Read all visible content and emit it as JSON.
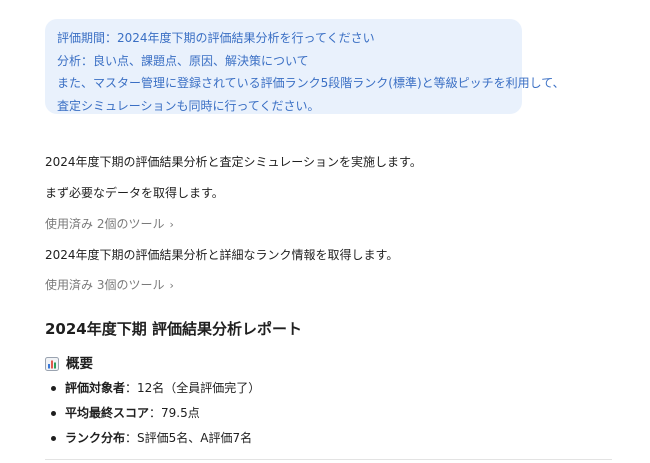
{
  "user_message": {
    "lines": [
      "評価期間：2024年度下期の評価結果分析を行ってください",
      "分析：良い点、課題点、原因、解決策について",
      "また、マスター管理に登録されている評価ランク5段階ランク(標準)と等級ピッチを利用して、",
      "査定シミュレーションも同時に行ってください。"
    ]
  },
  "assistant": {
    "intro": "2024年度下期の評価結果分析と査定シミュレーションを実施します。",
    "step1": "まず必要なデータを取得します。",
    "tools1": "使用済み 2個のツール",
    "step2": "2024年度下期の評価結果分析と詳細なランク情報を取得します。",
    "tools2": "使用済み 3個のツール",
    "chevron": "›",
    "report_title": "2024年度下期 評価結果分析レポート",
    "overview_icon": "bar-chart-icon",
    "overview_title": "概要",
    "bullets": [
      {
        "label": "評価対象者",
        "value": "：12名（全員評価完了）"
      },
      {
        "label": "平均最終スコア",
        "value": "：79.5点"
      },
      {
        "label": "ランク分布",
        "value": "：S評価5名、A評価7名"
      }
    ]
  },
  "colors": {
    "bubble_bg": "#e9f1fc",
    "bubble_text": "#3a6fc4",
    "muted": "#7a7a7a",
    "text": "#1f1f1f"
  }
}
